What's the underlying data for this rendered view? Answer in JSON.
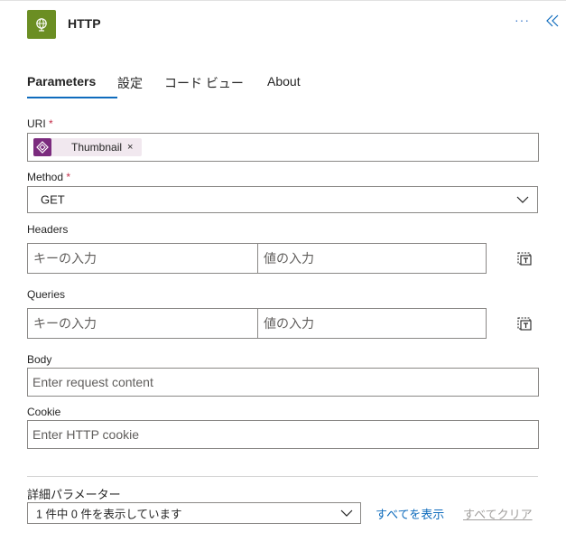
{
  "header": {
    "title": "HTTP",
    "more_label": "···",
    "app_icon": "globe-icon",
    "collapse_icon": "double-chevron-left-icon",
    "accent": "#6b8e23"
  },
  "tabs": [
    {
      "label": "Parameters",
      "active": true
    },
    {
      "label": "設定",
      "active": false
    },
    {
      "label": "コード ビュー",
      "active": false
    },
    {
      "label": "About",
      "active": false
    }
  ],
  "uri": {
    "label": "URI",
    "required_mark": "*",
    "token": {
      "label": "Thumbnail",
      "remove": "×",
      "icon": "dynamic-content-icon",
      "color": "#7b2b7e"
    }
  },
  "method": {
    "label": "Method",
    "required_mark": "*",
    "value": "GET"
  },
  "headers": {
    "label": "Headers",
    "key_placeholder": "キーの入力",
    "value_placeholder": "値の入力"
  },
  "queries": {
    "label": "Queries",
    "key_placeholder": "キーの入力",
    "value_placeholder": "値の入力"
  },
  "body": {
    "label": "Body",
    "placeholder": "Enter request content"
  },
  "cookie": {
    "label": "Cookie",
    "placeholder": "Enter HTTP cookie"
  },
  "advanced": {
    "label": "詳細パラメーター",
    "selected": "1 件中 0 件を表示しています",
    "show_all": "すべてを表示",
    "clear_all": "すべてクリア"
  },
  "colors": {
    "link": "#0f6cbd",
    "disabled": "#a19f9d",
    "required": "#c4314b"
  }
}
